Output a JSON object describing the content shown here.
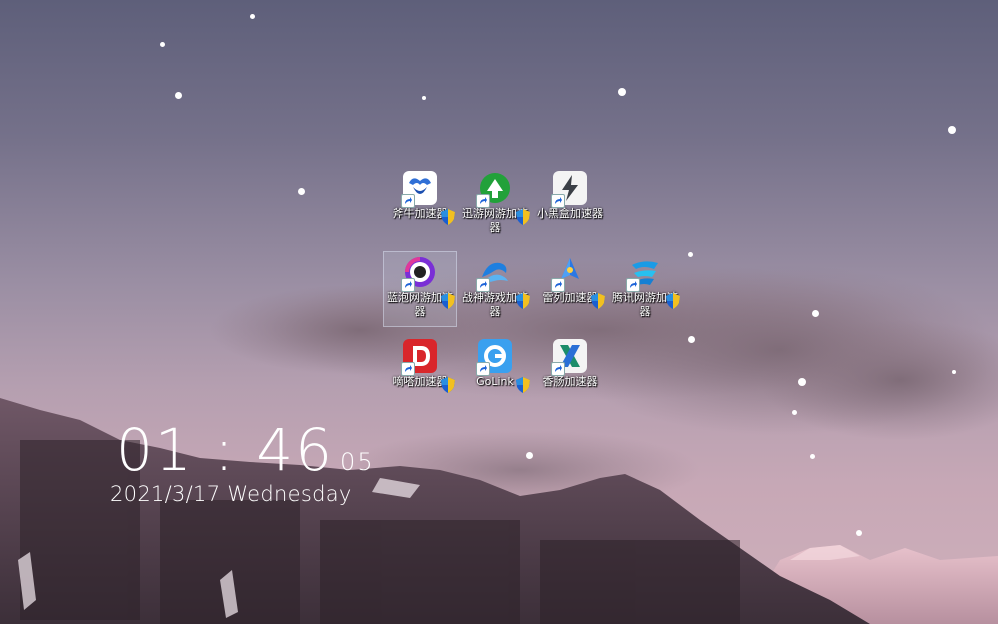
{
  "desktop": {
    "icons": [
      {
        "label": "斧牛加速器",
        "icon": "bull-icon",
        "color": "#2f6fd6"
      },
      {
        "label": "迅游网游加速器",
        "icon": "globe-arrow-icon",
        "color": "#22a13a"
      },
      {
        "label": "小黑盒加速器",
        "icon": "lightning-box-icon",
        "color": "#3b3f46"
      },
      {
        "label": "蓝泡网游加速器",
        "icon": "bubble-ring-icon",
        "color": "#7a2fd6",
        "selected": true
      },
      {
        "label": "战神游戏加速器",
        "icon": "wave-icon",
        "color": "#1e7fe0"
      },
      {
        "label": "雷列加速器",
        "icon": "rocket-icon",
        "color": "#2a78e4"
      },
      {
        "label": "腾讯网游加速器",
        "icon": "tencent-wave-icon",
        "color": "#1a9be6"
      },
      {
        "label": "嘀嗒加速器",
        "icon": "letter-d-icon",
        "color": "#d9262b"
      },
      {
        "label": "GoLink",
        "icon": "golink-icon",
        "color": "#3aa0ef"
      },
      {
        "label": "香肠加速器",
        "icon": "x-swirl-icon",
        "color": "#1c8d6a"
      }
    ]
  },
  "clock": {
    "hour": "01",
    "separator": ":",
    "minute": "46",
    "second": "05",
    "date": "2021/3/17 Wednesday"
  }
}
